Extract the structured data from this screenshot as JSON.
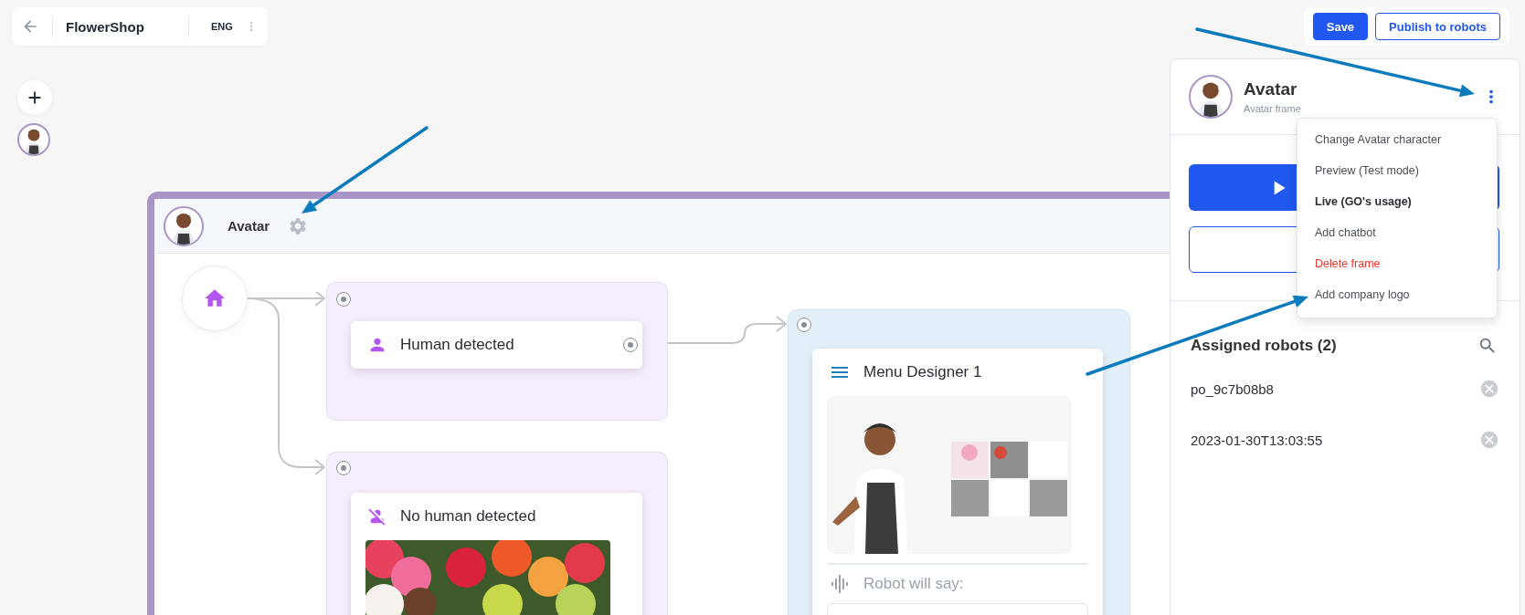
{
  "toolbar": {
    "title": "FlowerShop",
    "language": "ENG"
  },
  "actions": [
    {
      "label": "Save",
      "kind": "primary"
    },
    {
      "label": "Publish to robots",
      "kind": "outline"
    }
  ],
  "frame": {
    "title": "Avatar"
  },
  "nodes": [
    {
      "label": "Human detected",
      "kind": "human"
    },
    {
      "label": "No human detected",
      "kind": "no-human"
    }
  ],
  "menu_node": {
    "title": "Menu Designer 1",
    "speech_label": "Robot will say:"
  },
  "panel": {
    "title": "Avatar",
    "subtitle": "Avatar frame",
    "section_title": "Assigned robots (2)",
    "robots": [
      {
        "name": "po_9c7b08b8"
      },
      {
        "name": "2023-01-30T13:03:55"
      }
    ]
  },
  "context_menu": {
    "items": [
      {
        "label": "Change Avatar character",
        "kind": "normal",
        "selected": false
      },
      {
        "label": "Preview (Test mode)",
        "kind": "normal",
        "selected": false
      },
      {
        "label": "Live (GO's usage)",
        "kind": "normal",
        "selected": true
      },
      {
        "label": "Add chatbot",
        "kind": "normal",
        "selected": false
      },
      {
        "label": "Delete frame",
        "kind": "danger",
        "selected": false
      },
      {
        "label": "Add company logo",
        "kind": "normal",
        "selected": false
      }
    ]
  }
}
